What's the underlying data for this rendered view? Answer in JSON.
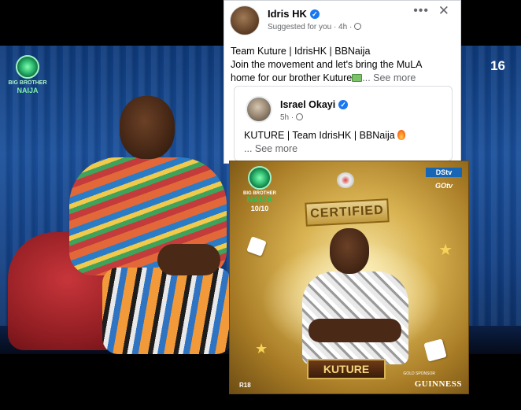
{
  "tv": {
    "logo_line1": "BIG BROTHER",
    "logo_line2": "NAIJA",
    "channel_number": "16"
  },
  "post": {
    "author": "Idris HK",
    "meta": "Suggested for you · 4h ·",
    "more_label": "•••",
    "close_label": "✕",
    "text_line1": "Team Kuture | IdrisHK | BBNaija",
    "text_line2": "Join the movement and let's bring the MuLA",
    "text_line3": "home for our brother Kuture",
    "see_more": "... See more"
  },
  "shared_post": {
    "author": "Israel Okayi",
    "meta": "5h ·",
    "text": "KUTURE | Team IdrisHK | BBNaija",
    "see_more": "... See more"
  },
  "poster": {
    "logo_line1": "BIG BROTHER",
    "logo_line2": "NAIJA",
    "logo_line3": "10/10",
    "badge": "CERTIFIED",
    "name": "KUTURE",
    "dstv": "DStv",
    "gotv": "GOtv",
    "footer_left": "R18",
    "sponsor_label": "GOLD SPONSOR",
    "sponsor": "GUINNESS"
  },
  "icons": {
    "verified": "verified-icon",
    "globe": "globe-icon",
    "money": "money-icon",
    "fire": "fire-icon"
  },
  "colors": {
    "facebook_blue": "#1877f2",
    "poster_gold": "#d9b352",
    "tv_blue": "#1a4f9a"
  }
}
